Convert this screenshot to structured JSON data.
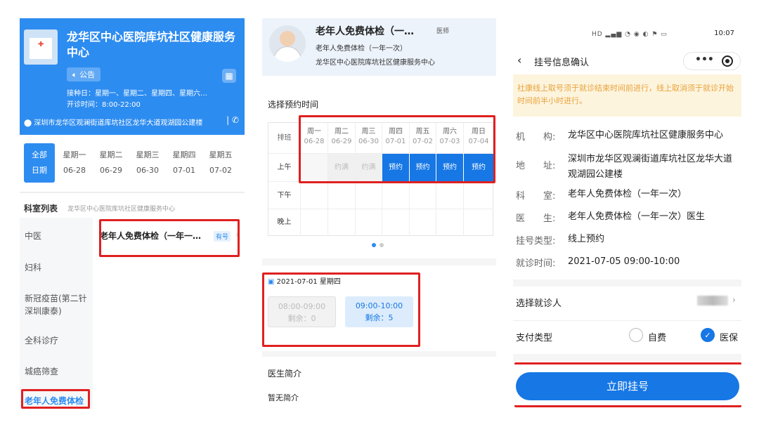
{
  "p1": {
    "title": "龙华区中心医院库坑社区健康服务中心",
    "notice": "公告",
    "schedule": "接种日：星期一、星期二、星期四、星期六…",
    "clinic_hours": "开诊时间：8:00-22:00",
    "address": "深圳市龙华区观澜街道库坑社区龙华大道观湖园公建楼",
    "days": [
      {
        "w": "全部",
        "d": "日期"
      },
      {
        "w": "星期一",
        "d": "06-28"
      },
      {
        "w": "星期二",
        "d": "06-29"
      },
      {
        "w": "星期三",
        "d": "06-30"
      },
      {
        "w": "星期四",
        "d": "07-01"
      },
      {
        "w": "星期五",
        "d": "07-02"
      }
    ],
    "dept_title": "科室列表",
    "dept_sub": "龙华区中心医院库坑社区健康服务中心",
    "sidebar": [
      "中医",
      "妇科",
      "新冠疫苗(第二针深圳康泰)",
      "全科诊疗",
      "城癌筛查",
      "老年人免费体检"
    ],
    "dept_item": "老年人免费体检（一年一…",
    "badge": "有号"
  },
  "p2": {
    "doc_name": "老年人免费体检（一…",
    "doc_tag": "医师",
    "doc_sub1": "老年人免费体检（一年一次）",
    "doc_sub2": "龙华区中心医院库坑社区健康服务中心",
    "section": "选择预约时间",
    "row_header": "排班",
    "cols": [
      {
        "w": "周一",
        "d": "06-28"
      },
      {
        "w": "周二",
        "d": "06-29"
      },
      {
        "w": "周三",
        "d": "06-30"
      },
      {
        "w": "周四",
        "d": "07-01"
      },
      {
        "w": "周五",
        "d": "07-02"
      },
      {
        "w": "周六",
        "d": "07-03"
      },
      {
        "w": "周日",
        "d": "07-04"
      }
    ],
    "rows": [
      "上午",
      "下午",
      "晚上"
    ],
    "morning": [
      "",
      "约满",
      "约满",
      "预约",
      "预约",
      "预约",
      "预约"
    ],
    "date_line": "2021-07-01 星期四",
    "slot1_time": "08:00-09:00",
    "slot1_left": "剩余：0",
    "slot2_time": "09:00-10:00",
    "slot2_left": "剩余：5",
    "intro_title": "医生简介",
    "intro_text": "暂无简介"
  },
  "p3": {
    "time": "10:07",
    "title": "挂号信息确认",
    "warn": "社康线上取号须于就诊结束时间前进行，线上取消须于就诊开始时间前半小时进行。",
    "rows": [
      {
        "k": "机　　构:",
        "v": "龙华区中心医院库坑社区健康服务中心"
      },
      {
        "k": "地　　址:",
        "v": "深圳市龙华区观澜街道库坑社区龙华大道观湖园公建楼"
      },
      {
        "k": "科　　室:",
        "v": "老年人免费体检（一年一次）"
      },
      {
        "k": "医　　生:",
        "v": "老年人免费体检（一年一次）医生"
      },
      {
        "k": "挂号类型:",
        "v": "线上预约"
      },
      {
        "k": "就诊时间:",
        "v": "2021-07-05 09:00-10:00"
      }
    ],
    "pick": "选择就诊人",
    "pay": "支付类型",
    "opt1": "自费",
    "opt2": "医保",
    "submit": "立即挂号"
  },
  "colors": {
    "primary": "#2d8cf0",
    "button": "#1677e5",
    "highlight": "#e02020",
    "warn_bg": "#fdf4dd"
  }
}
